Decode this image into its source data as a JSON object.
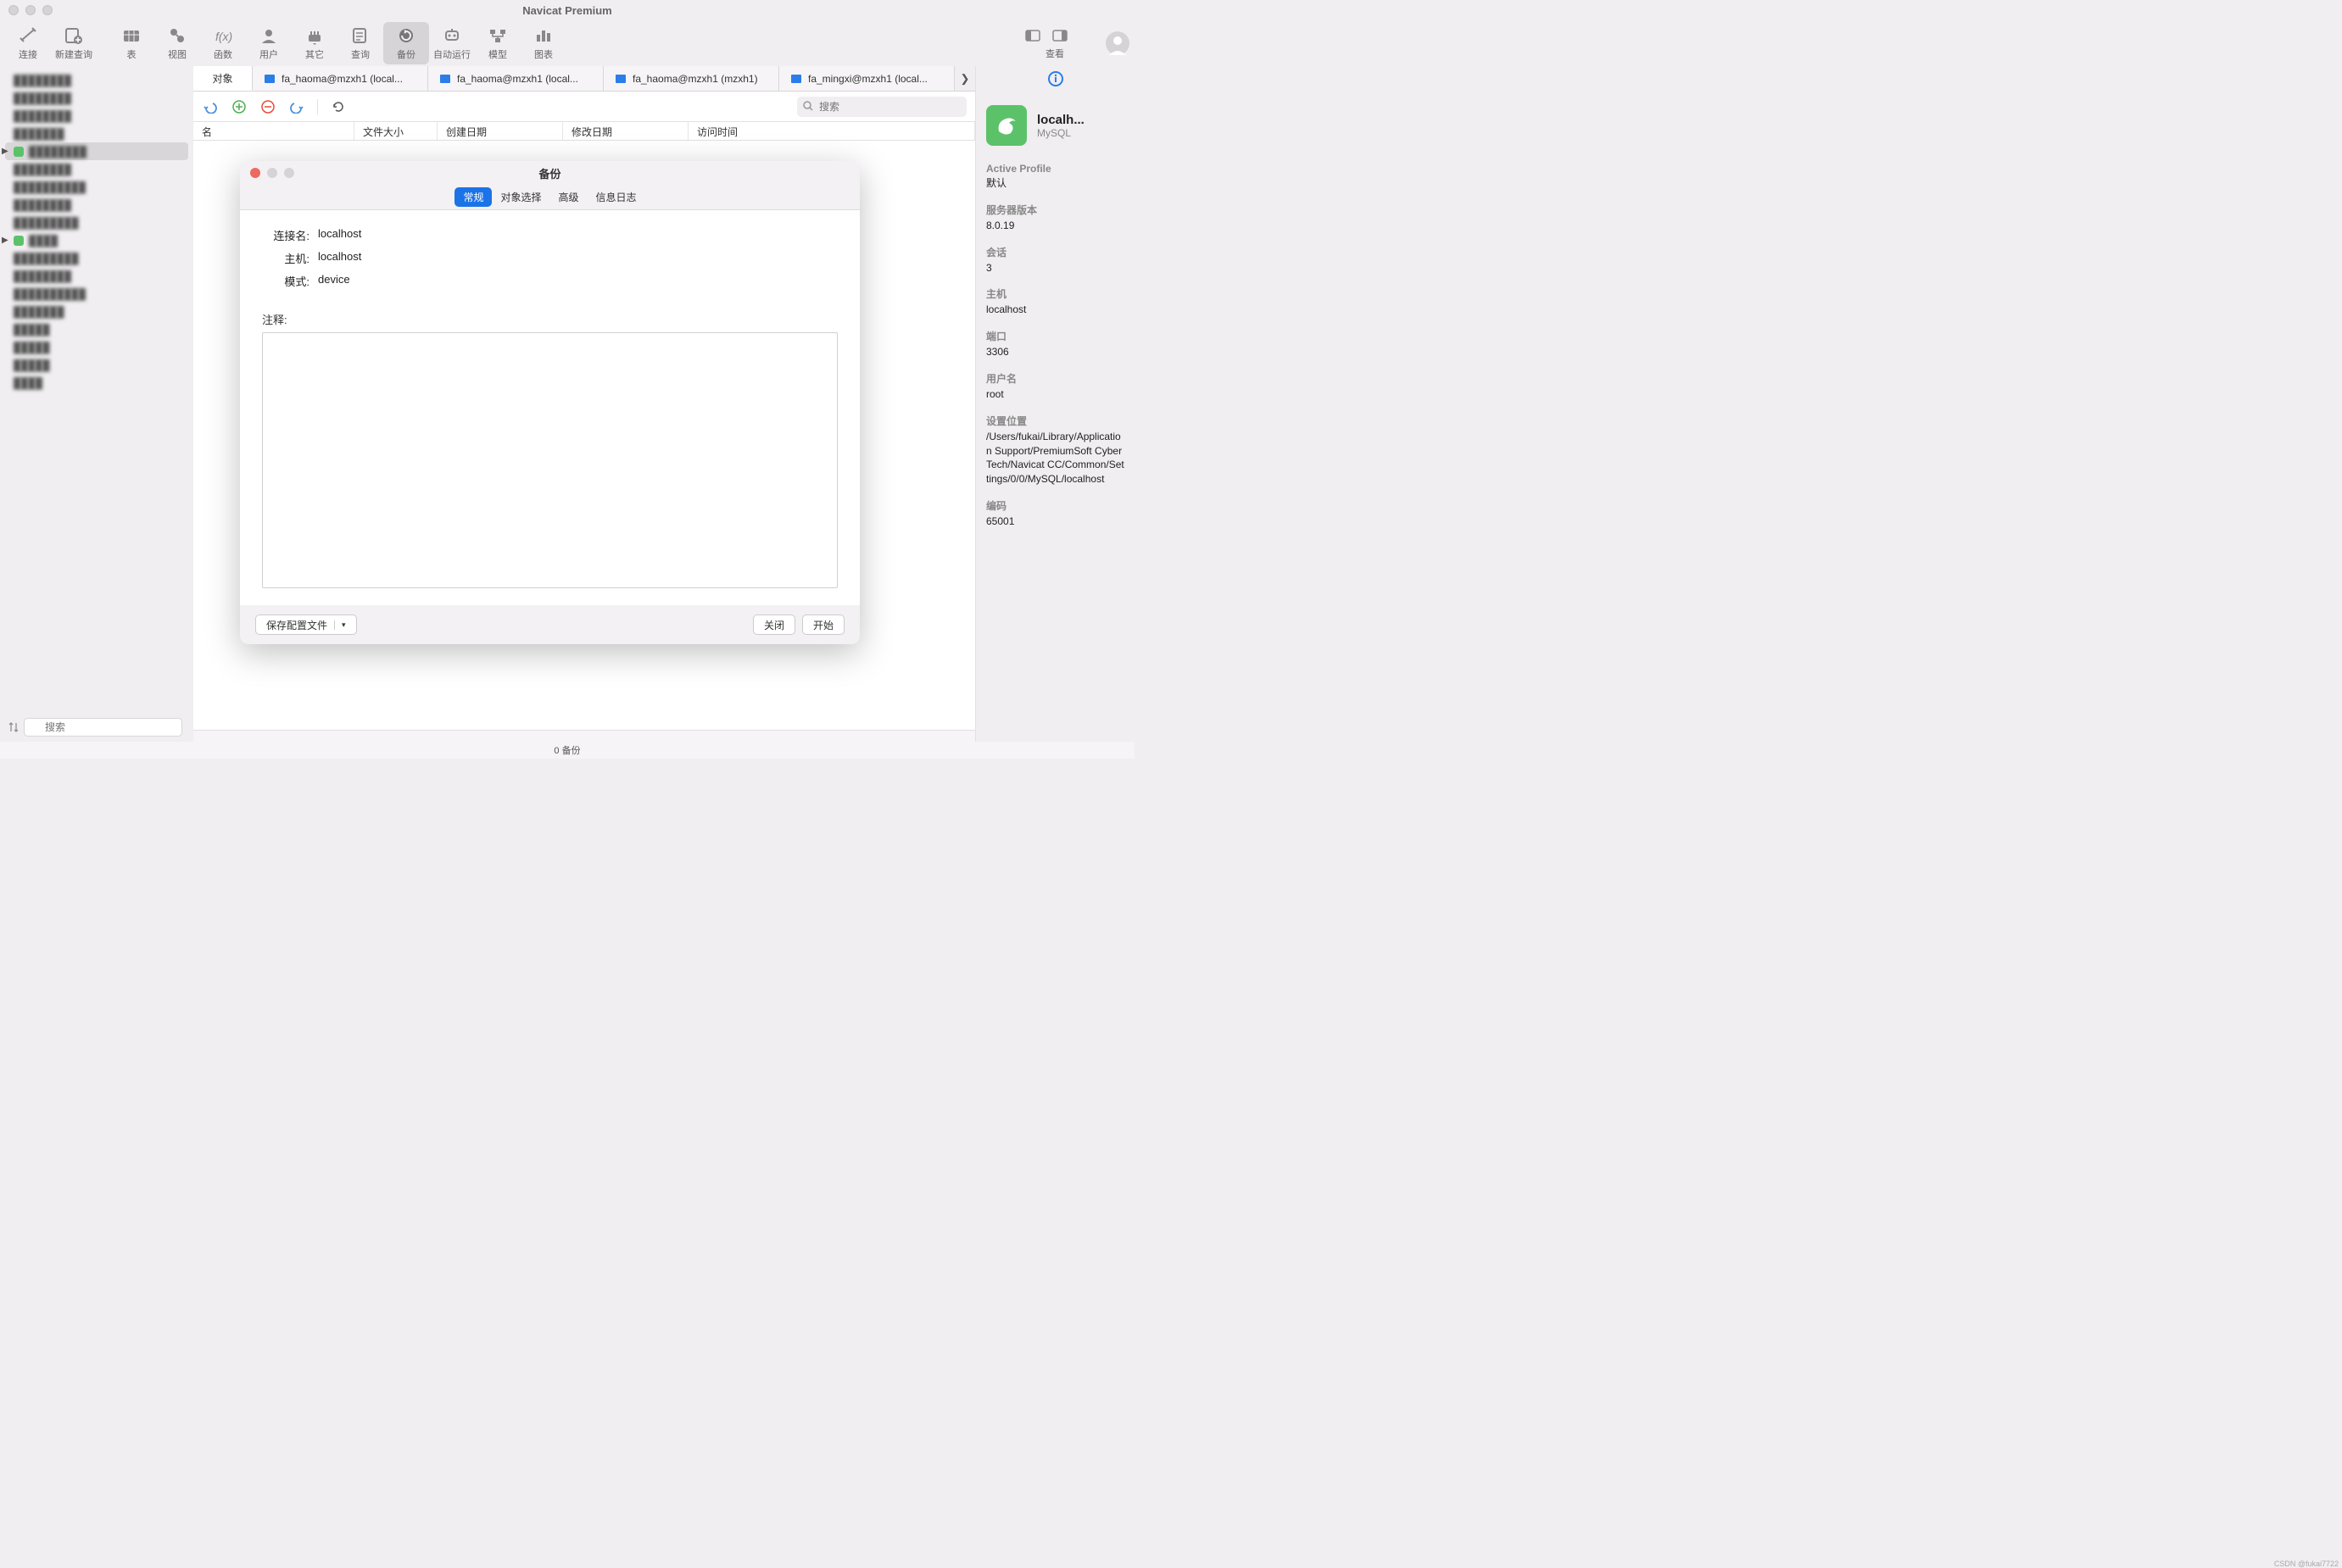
{
  "app": {
    "title": "Navicat Premium"
  },
  "toolbar": {
    "items": [
      {
        "label": "连接"
      },
      {
        "label": "新建查询"
      },
      {
        "label": "表"
      },
      {
        "label": "视图"
      },
      {
        "label": "函数"
      },
      {
        "label": "用户"
      },
      {
        "label": "其它"
      },
      {
        "label": "查询"
      },
      {
        "label": "备份"
      },
      {
        "label": "自动运行"
      },
      {
        "label": "模型"
      },
      {
        "label": "图表"
      }
    ],
    "view_label": "查看"
  },
  "tabs": {
    "object": "对象",
    "items": [
      {
        "label": "fa_haoma@mzxh1 (local..."
      },
      {
        "label": "fa_haoma@mzxh1 (local..."
      },
      {
        "label": "fa_haoma@mzxh1 (mzxh1)"
      },
      {
        "label": "fa_mingxi@mzxh1 (local..."
      }
    ]
  },
  "toolbar2": {
    "search_placeholder": "搜索"
  },
  "columns": {
    "c0": "名",
    "c1": "文件大小",
    "c2": "创建日期",
    "c3": "修改日期",
    "c4": "访问时间"
  },
  "status": "0 备份",
  "sidebar": {
    "search_placeholder": "搜索"
  },
  "rightPanel": {
    "title": "localh...",
    "subtitle": "MySQL",
    "fields": [
      {
        "label": "Active Profile",
        "value": "默认"
      },
      {
        "label": "服务器版本",
        "value": "8.0.19"
      },
      {
        "label": "会话",
        "value": "3"
      },
      {
        "label": "主机",
        "value": "localhost"
      },
      {
        "label": "端口",
        "value": "3306"
      },
      {
        "label": "用户名",
        "value": "root"
      },
      {
        "label": "设置位置",
        "value": "/Users/fukai/Library/Application Support/PremiumSoft CyberTech/Navicat CC/Common/Settings/0/0/MySQL/localhost"
      },
      {
        "label": "编码",
        "value": "65001"
      }
    ]
  },
  "dialog": {
    "title": "备份",
    "tabs": {
      "t0": "常规",
      "t1": "对象选择",
      "t2": "高级",
      "t3": "信息日志"
    },
    "form": {
      "connection_label": "连接名:",
      "connection_value": "localhost",
      "host_label": "主机:",
      "host_value": "localhost",
      "schema_label": "模式:",
      "schema_value": "device",
      "comment_label": "注释:"
    },
    "footer": {
      "save": "保存配置文件",
      "close": "关闭",
      "start": "开始"
    }
  },
  "watermark": "CSDN @fukai7722"
}
